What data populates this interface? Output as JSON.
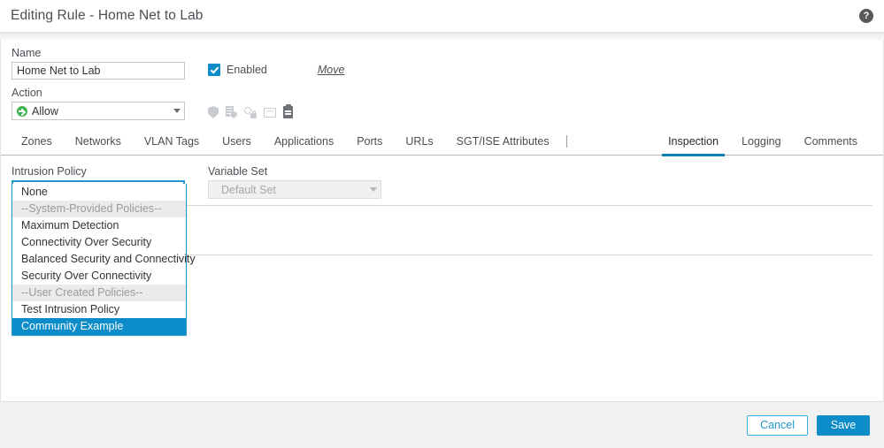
{
  "titlebar": {
    "title": "Editing Rule - Home Net to Lab",
    "help_glyph": "?"
  },
  "form": {
    "name_label": "Name",
    "name_value": "Home Net to Lab",
    "name_placeholder": "Name",
    "enabled_label": "Enabled",
    "enabled_checked": true,
    "move_label": "Move",
    "action_label": "Action",
    "action_value": "Allow"
  },
  "inline_icons": [
    {
      "name": "shield-icon"
    },
    {
      "name": "file-policy-icon"
    },
    {
      "name": "identity-inspection-icon"
    },
    {
      "name": "preview-icon"
    },
    {
      "name": "logging-icon"
    }
  ],
  "tabs": {
    "left": [
      {
        "label": "Zones",
        "active": false
      },
      {
        "label": "Networks",
        "active": false
      },
      {
        "label": "VLAN Tags",
        "active": false
      },
      {
        "label": "Users",
        "active": false
      },
      {
        "label": "Applications",
        "active": false
      },
      {
        "label": "Ports",
        "active": false
      },
      {
        "label": "URLs",
        "active": false
      },
      {
        "label": "SGT/ISE Attributes",
        "active": false
      }
    ],
    "right": [
      {
        "label": "Inspection",
        "active": true
      },
      {
        "label": "Logging",
        "active": false
      },
      {
        "label": "Comments",
        "active": false
      }
    ]
  },
  "inspection": {
    "intrusion_policy_label": "Intrusion Policy",
    "intrusion_policy_value": "None",
    "variable_set_label": "Variable Set",
    "variable_set_value": "Default Set",
    "variable_set_disabled": true,
    "dropdown_open": true,
    "dropdown_options": [
      {
        "label": "None",
        "type": "option",
        "selected": false
      },
      {
        "label": "--System-Provided Policies--",
        "type": "group",
        "selected": false
      },
      {
        "label": "Maximum Detection",
        "type": "option",
        "selected": false
      },
      {
        "label": "Connectivity Over Security",
        "type": "option",
        "selected": false
      },
      {
        "label": "Balanced Security and Connectivity",
        "type": "option",
        "selected": false
      },
      {
        "label": "Security Over Connectivity",
        "type": "option",
        "selected": false
      },
      {
        "label": "--User Created Policies--",
        "type": "group",
        "selected": false
      },
      {
        "label": "Test Intrusion Policy",
        "type": "option",
        "selected": false
      },
      {
        "label": "Community Example",
        "type": "option",
        "selected": true
      }
    ]
  },
  "footer": {
    "cancel_label": "Cancel",
    "save_label": "Save"
  },
  "colors": {
    "accent_blue": "#0c8cc9",
    "tab_underline": "#0c7fb5",
    "focus_border": "#2196cd",
    "allow_green": "#3fb34f",
    "footer_bg": "#f1f1f1",
    "group_row_bg": "#ebebeb"
  }
}
